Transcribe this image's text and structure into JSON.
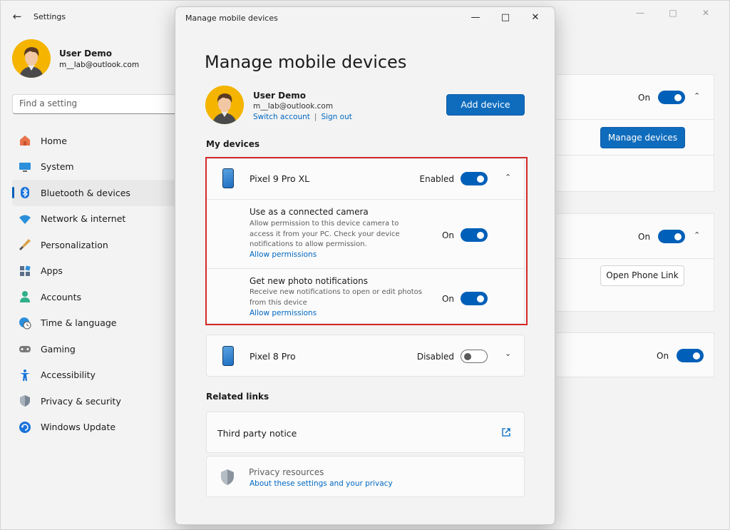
{
  "settings": {
    "title": "Settings",
    "user": {
      "name": "User Demo",
      "email": "m__lab@outlook.com"
    },
    "search_placeholder": "Find a setting",
    "nav": [
      {
        "label": "Home",
        "icon": "home-icon"
      },
      {
        "label": "System",
        "icon": "monitor-icon"
      },
      {
        "label": "Bluetooth & devices",
        "icon": "bluetooth-icon",
        "active": true
      },
      {
        "label": "Network & internet",
        "icon": "wifi-icon"
      },
      {
        "label": "Personalization",
        "icon": "brush-icon"
      },
      {
        "label": "Apps",
        "icon": "apps-icon"
      },
      {
        "label": "Accounts",
        "icon": "person-icon"
      },
      {
        "label": "Time & language",
        "icon": "clock-globe-icon"
      },
      {
        "label": "Gaming",
        "icon": "gamepad-icon"
      },
      {
        "label": "Accessibility",
        "icon": "accessibility-icon"
      },
      {
        "label": "Privacy & security",
        "icon": "shield-icon"
      },
      {
        "label": "Windows Update",
        "icon": "refresh-icon"
      }
    ],
    "cards": {
      "mobile": {
        "state": "On",
        "button": "Manage devices"
      },
      "phonelink": {
        "state": "On",
        "button": "Open Phone Link"
      },
      "third": {
        "state": "On"
      }
    }
  },
  "dialog": {
    "window_title": "Manage mobile devices",
    "heading": "Manage mobile devices",
    "account": {
      "name": "User Demo",
      "email": "m__lab@outlook.com",
      "switch_link": "Switch account",
      "separator": "|",
      "signout_link": "Sign out"
    },
    "add_device_label": "Add device",
    "my_devices_label": "My devices",
    "devices": [
      {
        "name": "Pixel 9 Pro XL",
        "status": "Enabled",
        "enabled": true,
        "expanded": true,
        "options": [
          {
            "title": "Use as a connected camera",
            "description": "Allow permission to this device camera to access it from your PC. Check your device notifications to allow permission.",
            "link": "Allow permissions",
            "state": "On"
          },
          {
            "title": "Get new photo notifications",
            "description": "Receive new notifications to open or edit photos from this device",
            "link": "Allow permissions",
            "state": "On"
          }
        ]
      },
      {
        "name": "Pixel 8 Pro",
        "status": "Disabled",
        "enabled": false,
        "expanded": false
      }
    ],
    "related_links_label": "Related links",
    "third_party": "Third party notice",
    "privacy": {
      "title": "Privacy resources",
      "link": "About these settings and your privacy"
    }
  },
  "colors": {
    "accent": "#005fb8",
    "link": "#0067c0",
    "highlight": "#d42a2a"
  }
}
